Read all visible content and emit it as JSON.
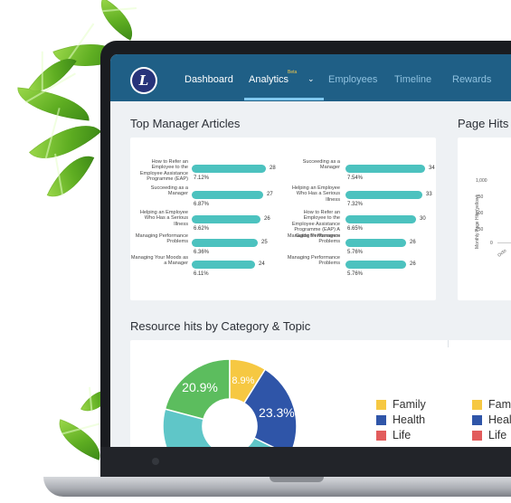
{
  "nav": {
    "logo_letter": "L",
    "items": [
      {
        "label": "Dashboard",
        "active": true
      },
      {
        "label": "Analytics",
        "active": false
      },
      {
        "label": "Employees",
        "active": false
      },
      {
        "label": "Timeline",
        "active": false
      },
      {
        "label": "Rewards",
        "active": false
      }
    ],
    "analytics_badge": "Beta",
    "chevron": "⌄"
  },
  "sections": {
    "top_manager_articles": "Top Manager Articles",
    "page_hits": "Page Hits O",
    "resource_hits": "Resource hits by Category & Topic"
  },
  "articles_left": [
    {
      "label": "How to Refer an Employee to the Employee Assistance Programme (EAP)",
      "value": "28",
      "pct": "7.12%"
    },
    {
      "label": "Succeeding as a Manager",
      "value": "27",
      "pct": "6.87%"
    },
    {
      "label": "Helping an Employee Who Has a Serious Illness",
      "value": "26",
      "pct": "6.62%"
    },
    {
      "label": "Managing Performance Problems",
      "value": "25",
      "pct": "6.36%"
    },
    {
      "label": "Managing Your Moods as a Manager",
      "value": "24",
      "pct": "6.11%"
    }
  ],
  "articles_right": [
    {
      "label": "Succeeding as a Manager",
      "value": "34",
      "pct": "7.54%"
    },
    {
      "label": "Helping an Employee Who Has a Serious Illness",
      "value": "33",
      "pct": "7.32%"
    },
    {
      "label": "How to Refer an Employee to the Employee Assistance Programme (EAP) A Guide for Managers",
      "value": "30",
      "pct": "6.65%"
    },
    {
      "label": "Managing Performance Problems",
      "value": "26",
      "pct": "5.76%"
    },
    {
      "label": "Managing Performance Problems",
      "value": "26",
      "pct": "5.76%"
    }
  ],
  "page_hits_chart": {
    "ylabel": "Monthly Page Hits (yellow)",
    "ticks": [
      "1,000",
      "750",
      "500",
      "250",
      "0"
    ],
    "x_tick": "Octo",
    "partial_tick": "3"
  },
  "chart_data": {
    "type": "pie",
    "categories": [
      "Family",
      "Health",
      "Life"
    ],
    "slices": [
      {
        "label": "20.9%",
        "value": 20.9,
        "color": "#5cbd5e"
      },
      {
        "label": "8.9%",
        "value": 8.9,
        "color": "#f6c842"
      },
      {
        "label": "23.3%",
        "value": 23.3,
        "color": "#2f55a8"
      },
      {
        "label": "",
        "value": 46.9,
        "color": "#5fc6c8"
      }
    ],
    "legend": [
      {
        "name": "Family",
        "color": "#f6c842"
      },
      {
        "name": "Health",
        "color": "#2f55a8"
      },
      {
        "name": "Life",
        "color": "#e25c5c"
      }
    ]
  },
  "legend_right": [
    {
      "name": "Fami",
      "color": "#f6c842"
    },
    {
      "name": "Heal",
      "color": "#2f55a8"
    },
    {
      "name": "Life",
      "color": "#e25c5c"
    }
  ],
  "colors": {
    "navbar": "#1f5f86",
    "bar": "#4cc2bf",
    "accent": "#7ec7ee"
  }
}
